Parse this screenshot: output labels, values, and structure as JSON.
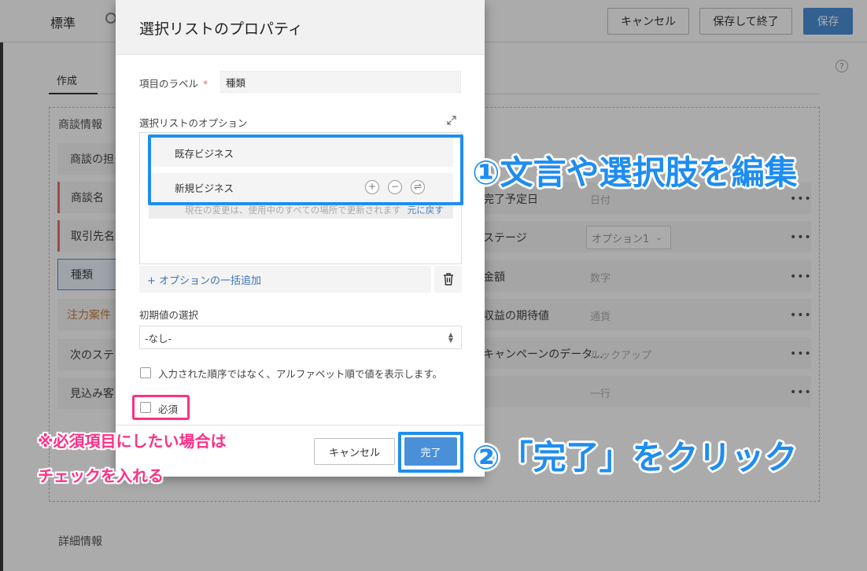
{
  "header": {
    "layout_name": "標準",
    "cancel_label": "キャンセル",
    "save_close_label": "保存して終了",
    "save_label": "保存"
  },
  "tabs": {
    "create_label": "作成",
    "help": "?"
  },
  "section": {
    "title": "商談情報",
    "left_fields": [
      "商談の担",
      "商談名",
      "取引先名",
      "種類",
      "注力案件",
      "次のステ",
      "見込み客"
    ],
    "right_fields": [
      {
        "label": "完了予定日",
        "type": "日付"
      },
      {
        "label": "ステージ",
        "type": "オプション1"
      },
      {
        "label": "金額",
        "type": "数字"
      },
      {
        "label": "収益の期待値",
        "type": "通貨"
      },
      {
        "label": "キャンペーンのデータ...",
        "type": "ルックアップ"
      },
      {
        "label": "",
        "type": "一行"
      }
    ],
    "dots": "•••"
  },
  "detail_section_title": "詳細情報",
  "modal": {
    "title": "選択リストのプロパティ",
    "field_label": "項目のラベル",
    "required_star": "*",
    "field_label_value": "種類",
    "options_label": "選択リストのオプション",
    "options": [
      "既存ビジネス",
      "新規ビジネス"
    ],
    "info_text": "現在の変更は、使用中のすべての場所で更新されます",
    "revert_link": "元に戻す",
    "bulk_add": "+ オプションの一括追加",
    "default_label": "初期値の選択",
    "default_value": "-なし-",
    "alpha_sort_label": "入力された順序ではなく、アルファベット順で値を表示します。",
    "required_label": "必須",
    "cancel_label": "キャンセル",
    "done_label": "完了"
  },
  "annotations": {
    "edit_note": "①文言や選択肢を編集",
    "click_done_note": "②「完了」をクリック",
    "required_note_line1": "※必須項目にしたい場合は",
    "required_note_line2": "チェックを入れる"
  },
  "colors": {
    "accent": "#4a90d9",
    "annotation_blue": "#1e8df0",
    "annotation_pink": "#ff2f86",
    "required_red": "#e6746f"
  }
}
